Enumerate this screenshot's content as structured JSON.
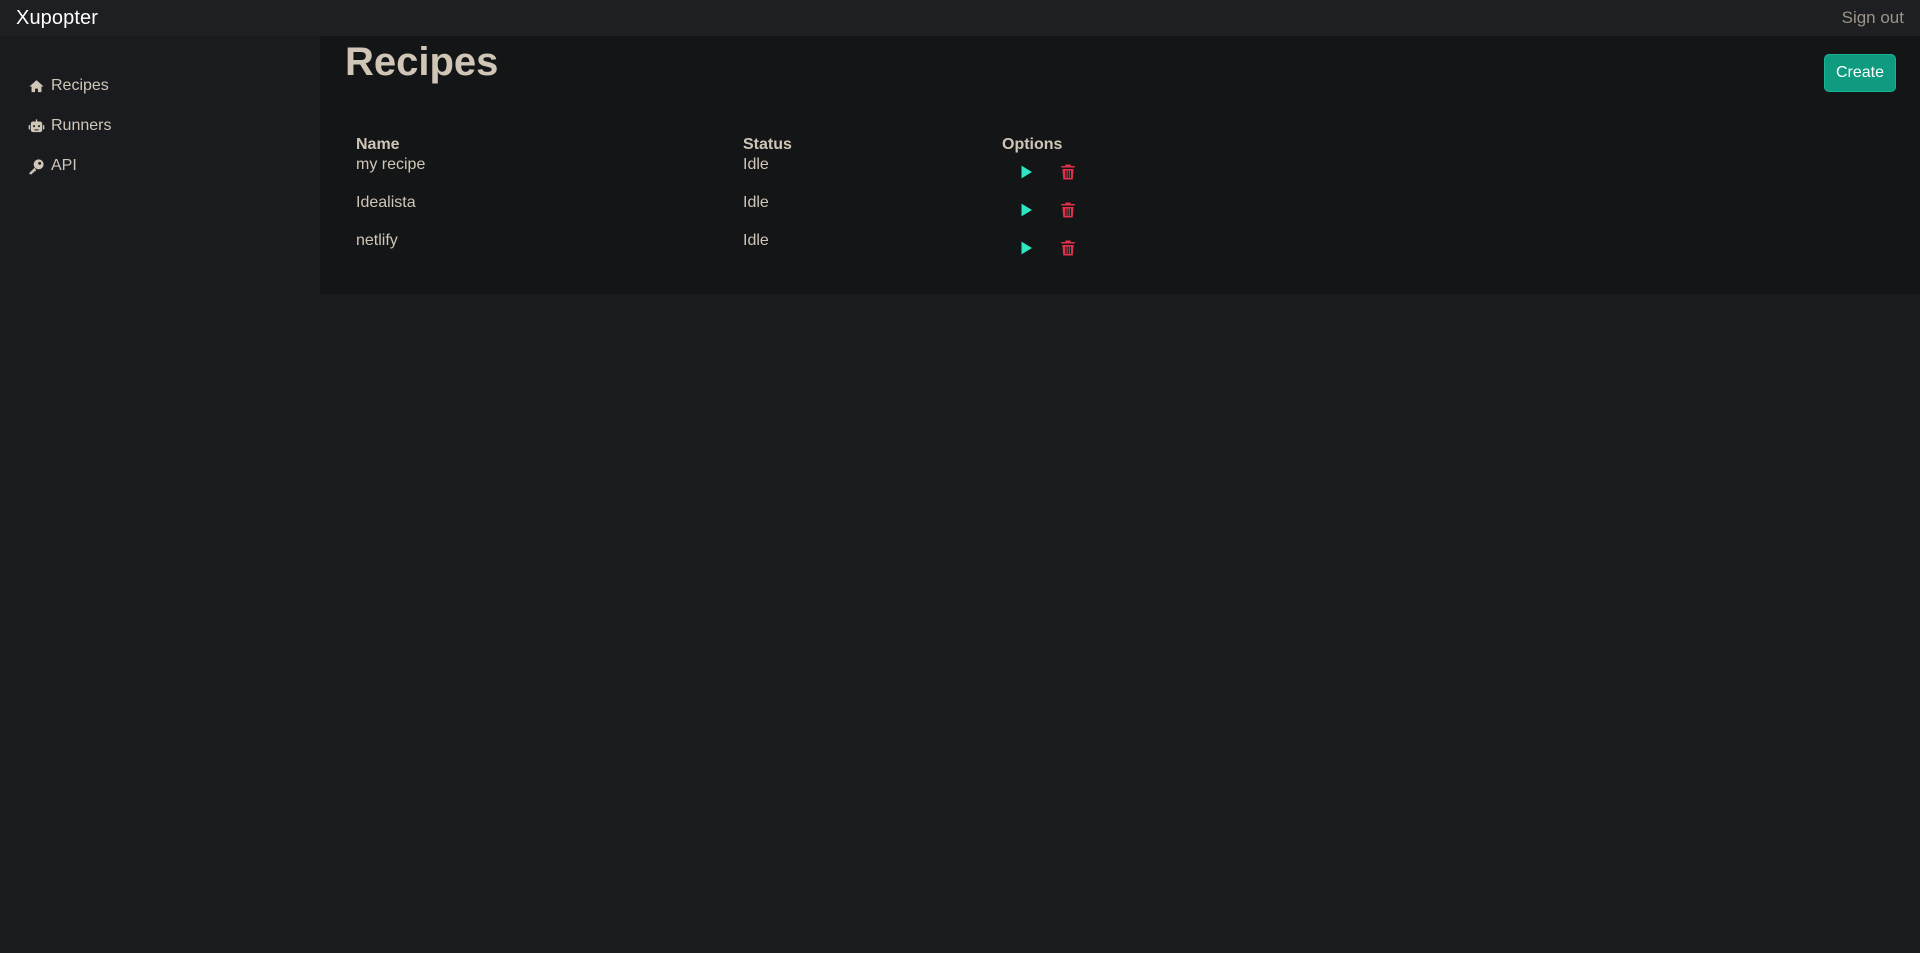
{
  "topbar": {
    "brand": "Xupopter",
    "signout_label": "Sign out"
  },
  "sidebar": {
    "items": [
      {
        "label": "Recipes",
        "icon": "house-icon"
      },
      {
        "label": "Runners",
        "icon": "robot-icon"
      },
      {
        "label": "API",
        "icon": "key-icon"
      }
    ]
  },
  "main": {
    "title": "Recipes",
    "create_label": "Create",
    "columns": [
      "Name",
      "Status",
      "Options"
    ],
    "rows": [
      {
        "name": "my recipe",
        "status": "Idle"
      },
      {
        "name": "Idealista",
        "status": "Idle"
      },
      {
        "name": "netlify",
        "status": "Idle"
      }
    ]
  },
  "colors": {
    "play": "#2ee6c4",
    "delete": "#e0304a",
    "create_button": "#0f9b7f"
  }
}
